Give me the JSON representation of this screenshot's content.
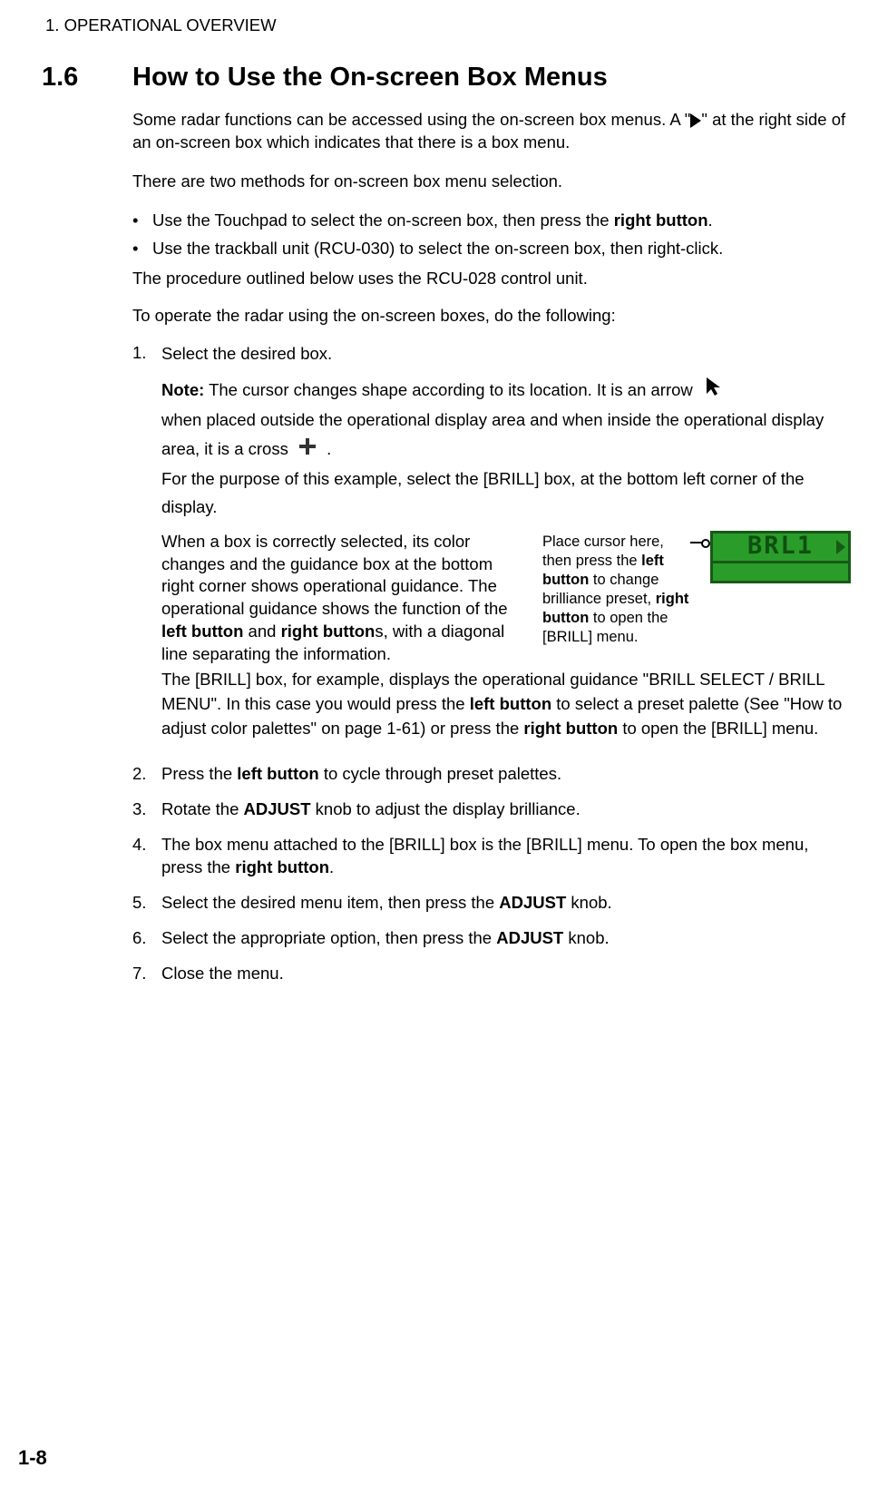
{
  "header": {
    "chapter": "1.  OPERATIONAL OVERVIEW"
  },
  "section": {
    "number": "1.6",
    "title": "How to Use the On-screen Box Menus"
  },
  "intro": {
    "p1a": "Some radar functions can be accessed using the on-screen box menus. A \"",
    "p1b": "\" at the right side of an on-screen box which indicates that there is a box menu.",
    "p2": "There are two methods for on-screen box menu selection."
  },
  "bullets": {
    "b1a": "Use the Touchpad to select the on-screen box, then press the ",
    "b1b": "right button",
    "b1c": ".",
    "b2": "Use the trackball unit (RCU-030) to select the on-screen box, then right-click."
  },
  "procedure": {
    "p1": "The procedure outlined below uses the RCU-028 control unit.",
    "p2": "To operate the radar using the on-screen boxes, do the following:"
  },
  "step1": {
    "a": "Select the desired box.",
    "note_label": "Note:",
    "b": " The cursor changes shape according to its location. It is an arrow",
    "c": "when placed outside the operational display area and when inside the operational display area, it is a cross ",
    "d": ".",
    "e": "For the purpose of this example, select the [BRILL] box, at the bottom left corner of the display.",
    "fig_left1": "When a box is correctly selected, its color changes and the guidance box at the bottom right corner shows operational guidance. The operational guidance shows the function of the ",
    "fig_left_b1": "left button",
    "fig_left2": " and ",
    "fig_left_b2": "right button",
    "fig_left3": "s, with a diagonal line separating the information.",
    "f1": "The [BRILL] box, for example, displays the operational guidance \"BRILL SELECT / BRILL MENU\". In this case you would press the ",
    "f1b": "left button",
    "f2": " to select a preset palette (See \"How to adjust color palettes\" on page 1-61) or press the ",
    "f2b": "right button",
    "f3": " to open the [BRILL] menu."
  },
  "fig_caption": {
    "a": "Place cursor here, then press the ",
    "b": "left button",
    "c": " to change brilliance preset, ",
    "d": "right button",
    "e": " to open the [BRILL] menu."
  },
  "brl_label": "BRL1",
  "steps": {
    "s2a": "Press the ",
    "s2b": "left button",
    "s2c": " to cycle through preset palettes.",
    "s3a": "Rotate the ",
    "s3b": "ADJUST",
    "s3c": " knob to adjust the display brilliance.",
    "s4a": "The box menu attached to the [BRILL] box is the [BRILL] menu. To open the box menu, press the ",
    "s4b": "right button",
    "s4c": ".",
    "s5a": "Select the desired menu item, then press the ",
    "s5b": "ADJUST",
    "s5c": " knob.",
    "s6a": "Select the appropriate option, then press the ",
    "s6b": "ADJUST",
    "s6c": " knob.",
    "s7": "Close the menu."
  },
  "page_number": "1-8"
}
